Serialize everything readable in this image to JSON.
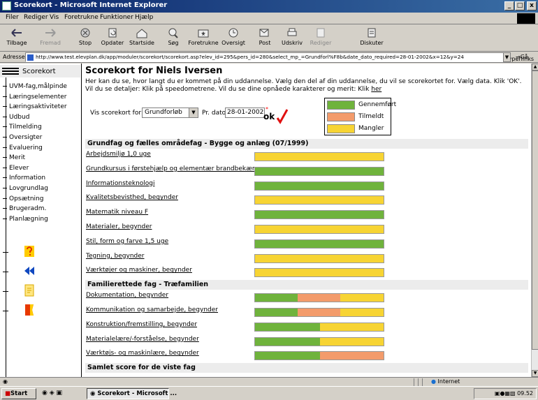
{
  "window": {
    "title": "Scorekort - Microsoft Internet Explorer"
  },
  "menu": [
    "Filer",
    "Rediger",
    "Vis",
    "Foretrukne",
    "Funktioner",
    "Hjælp"
  ],
  "toolbar": {
    "buttons": [
      "Tilbage",
      "Fremad",
      "Stop",
      "Opdater",
      "Startside",
      "Søg",
      "Foretrukne",
      "Oversigt",
      "Post",
      "Udskriv",
      "Rediger",
      "Diskuter"
    ],
    "hyperlinks": "Hyperlinks"
  },
  "address": {
    "label": "Adresse",
    "url": "http://www.test.elevplan.dk/app/moduler/scorekort/scorekort.asp?elev_id=295&pers_id=280&select_mp_=Grundforl%F8b&date_dato_required=28-01-2002&x=12&y=24",
    "go": "Gå"
  },
  "sidebar": {
    "header": "Scorekort",
    "items": [
      "UVM-fag,målpinde",
      "Læringselementer",
      "Læringsaktiviteter",
      "Udbud",
      "Tilmelding",
      "Oversigter",
      "Evaluering",
      "Merit",
      "Elever",
      "Information",
      "Lovgrundlag",
      "Opsætning",
      "Brugeradm.",
      "Planlægning"
    ]
  },
  "page": {
    "title": "Scorekort for Niels Iversen",
    "intro": "Her kan du se, hvor langt du er kommet på din uddannelse. Vælg den del af din uddannelse, du vil se scorekortet for. Vælg data. Klik 'OK'. Vil du se detaljer: Klik på speedometrene. Vil du se dine opnåede karakterer og merit: Klik ",
    "intro_link": "her",
    "select_label": "Vis scorekort for:",
    "select_value": "Grundforløb",
    "date_label": "Pr. dato",
    "date_value": "28-01-2002",
    "required_mark": "*",
    "ok_label": "ok"
  },
  "legend": [
    {
      "label": "Gennemført",
      "color": "#6fb33c"
    },
    {
      "label": "Tilmeldt",
      "color": "#f39b6b"
    },
    {
      "label": "Mangler",
      "color": "#f7d433"
    }
  ],
  "sections": [
    {
      "title": "Grundfag og fælles områdefag - Bygge og anlæg (07/1999)",
      "rows": [
        {
          "label": "Arbejdsmiljø 1,0 uge",
          "done": 0,
          "enrolled": 0
        },
        {
          "label": "Grundkursus i førstehjælp og elementær brandbekæmp",
          "done": 1,
          "enrolled": 0
        },
        {
          "label": "Informationsteknologi",
          "done": 1,
          "enrolled": 0
        },
        {
          "label": "Kvalitetsbevisthed, begynder",
          "done": 0,
          "enrolled": 0
        },
        {
          "label": "Matematik niveau F",
          "done": 1,
          "enrolled": 0
        },
        {
          "label": "Materialer, begynder",
          "done": 0,
          "enrolled": 0
        },
        {
          "label": "Stil, form og farve 1,5 uge",
          "done": 1,
          "enrolled": 0
        },
        {
          "label": "Tegning, begynder",
          "done": 0,
          "enrolled": 0
        },
        {
          "label": "Værktøjer og maskiner, begynder",
          "done": 0,
          "enrolled": 0
        }
      ]
    },
    {
      "title": "Familierettede fag - Træfamilien",
      "rows": [
        {
          "label": "Dokumentation, begynder",
          "done": 0.33,
          "enrolled": 0.33
        },
        {
          "label": "Kommunikation og samarbejde, begynder",
          "done": 0.33,
          "enrolled": 0.33
        },
        {
          "label": "Konstruktion/fremstilling, begynder",
          "done": 0.5,
          "enrolled": 0
        },
        {
          "label": "Materialelære/-forståelse, begynder",
          "done": 0.5,
          "enrolled": 0
        },
        {
          "label": "Værktøjs- og maskinlære, begynder",
          "done": 0.5,
          "enrolled": 0.5
        }
      ]
    },
    {
      "title": "Samlet score for de viste fag",
      "rows": []
    }
  ],
  "status": {
    "zone": "Internet"
  },
  "taskbar": {
    "start": "Start",
    "task": "Scorekort - Microsoft ...",
    "clock": "09.52"
  }
}
